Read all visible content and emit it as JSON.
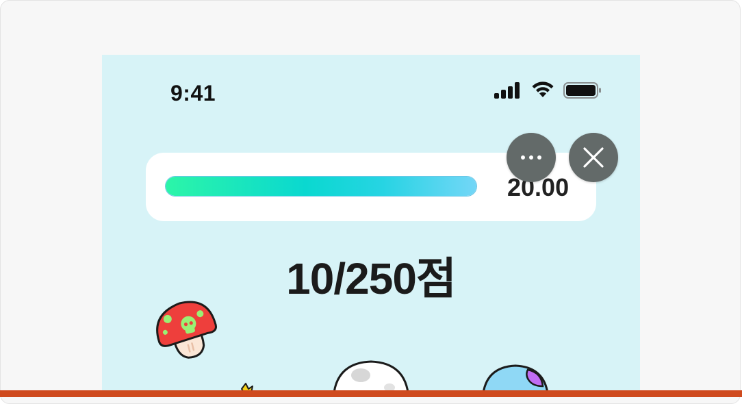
{
  "status_bar": {
    "time": "9:41",
    "signal_icon": "cellular-signal-icon",
    "wifi_icon": "wifi-icon",
    "battery_icon": "battery-icon"
  },
  "game": {
    "timer": {
      "value": "20.00",
      "progress_fraction": 1.0
    },
    "score_label": "10/250점",
    "sprites": [
      "red-mushroom-icon",
      "yellow-star-icon",
      "white-egg-icon",
      "blue-egg-icon"
    ]
  },
  "controls": {
    "more_icon": "more-dots-icon",
    "close_icon": "close-icon"
  },
  "colors": {
    "background": "#d7f3f7",
    "progress_start": "#2cf5a8",
    "progress_end": "#73d6f7",
    "control_button": "#636a69",
    "bottom_bar": "#cf4a1e"
  }
}
